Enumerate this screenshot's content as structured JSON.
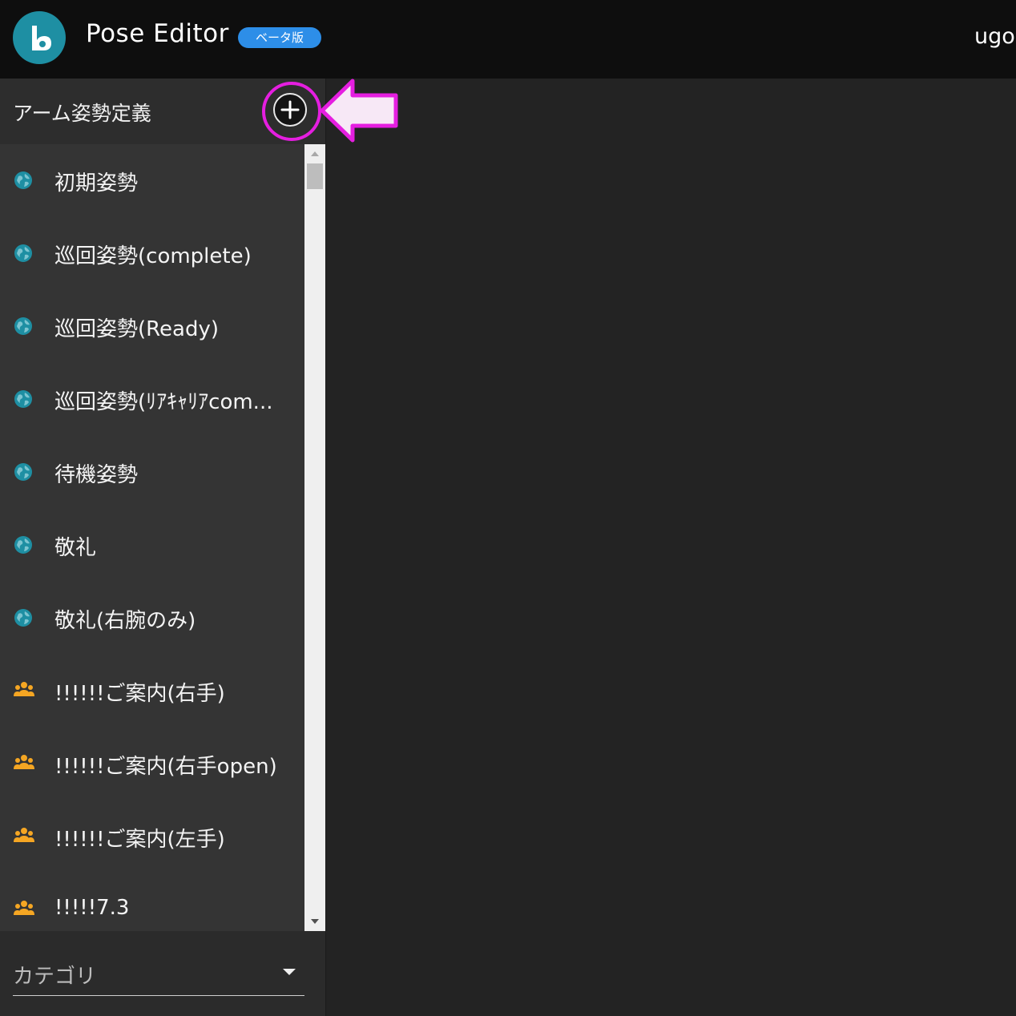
{
  "header": {
    "title": "Pose Editor",
    "badge": "ベータ版",
    "user": "ugo"
  },
  "sidebar": {
    "title": "アーム姿勢定義",
    "items": [
      {
        "label": "初期姿勢",
        "icon": "globe-icon"
      },
      {
        "label": "巡回姿勢(complete)",
        "icon": "globe-icon"
      },
      {
        "label": "巡回姿勢(Ready)",
        "icon": "globe-icon"
      },
      {
        "label": "巡回姿勢(ﾘｱｷｬﾘｱcom...",
        "icon": "globe-icon"
      },
      {
        "label": "待機姿勢",
        "icon": "globe-icon"
      },
      {
        "label": "敬礼",
        "icon": "globe-icon"
      },
      {
        "label": "敬礼(右腕のみ)",
        "icon": "globe-icon"
      },
      {
        "label": "!!!!!!ご案内(右手)",
        "icon": "group-icon"
      },
      {
        "label": "!!!!!!ご案内(右手open)",
        "icon": "group-icon"
      },
      {
        "label": "!!!!!!ご案内(左手)",
        "icon": "group-icon"
      },
      {
        "label": "!!!!!7.3",
        "icon": "group-icon"
      }
    ],
    "category_placeholder": "カテゴリ"
  },
  "colors": {
    "accent": "#1e8fa3",
    "highlight": "#e51ee0",
    "badge": "#2d8ee8",
    "shared_icon": "#f5a623"
  }
}
